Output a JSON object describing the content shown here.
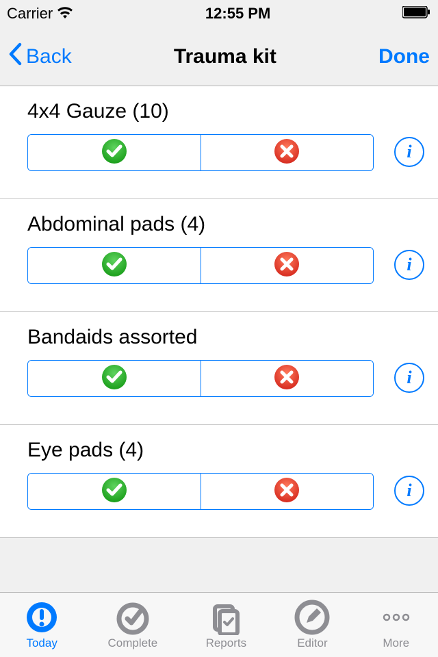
{
  "status": {
    "carrier": "Carrier",
    "time": "12:55 PM"
  },
  "nav": {
    "back": "Back",
    "title": "Trauma kit",
    "done": "Done"
  },
  "items": [
    {
      "title": "4x4 Gauze (10)"
    },
    {
      "title": "Abdominal pads (4)"
    },
    {
      "title": "Bandaids assorted"
    },
    {
      "title": "Eye pads (4)"
    }
  ],
  "tabs": [
    {
      "label": "Today",
      "active": true
    },
    {
      "label": "Complete",
      "active": false
    },
    {
      "label": "Reports",
      "active": false
    },
    {
      "label": "Editor",
      "active": false
    },
    {
      "label": "More",
      "active": false
    }
  ]
}
